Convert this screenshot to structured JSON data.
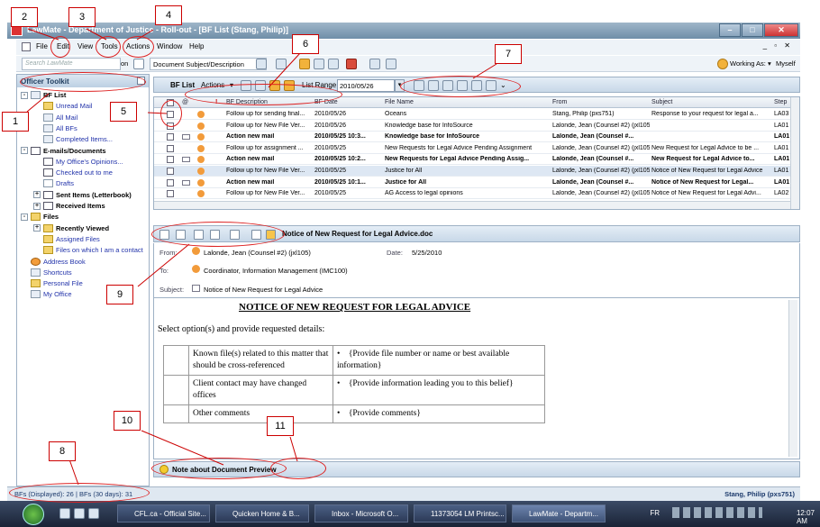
{
  "window": {
    "title": "LawMate - Department of Justice - Roll-out - [BF List (Stang, Philip)]"
  },
  "menu": [
    "File",
    "Edit",
    "View",
    "Tools",
    "Actions",
    "Window",
    "Help"
  ],
  "toolbar": {
    "search_placeholder": "Search LawMate",
    "on_label": "on",
    "search_scope": "Document Subject/Description",
    "working_as_label": "Working As:",
    "working_as_value": "Myself"
  },
  "sidebar": {
    "title": "Officer Toolkit",
    "items": [
      {
        "label": "BF List",
        "level": 0,
        "bold": true,
        "link": false,
        "icon": "list-icon",
        "toggle": "-"
      },
      {
        "label": "Unread Mail",
        "level": 1,
        "bold": false,
        "link": true,
        "icon": "folder-icon"
      },
      {
        "label": "All Mail",
        "level": 1,
        "bold": false,
        "link": true,
        "icon": "mail-icon"
      },
      {
        "label": "All BFs",
        "level": 1,
        "bold": false,
        "link": true,
        "icon": "list-icon"
      },
      {
        "label": "Completed Items...",
        "level": 1,
        "bold": false,
        "link": true,
        "icon": "check-icon"
      },
      {
        "label": "E-mails/Documents",
        "level": 0,
        "bold": true,
        "link": false,
        "icon": "document-icon",
        "toggle": "-"
      },
      {
        "label": "My Office's Opinions...",
        "level": 1,
        "bold": false,
        "link": true,
        "icon": "document-icon"
      },
      {
        "label": "Checked out to me",
        "level": 1,
        "bold": false,
        "link": true,
        "icon": "document-icon"
      },
      {
        "label": "Drafts",
        "level": 1,
        "bold": false,
        "link": true,
        "icon": "pencil-icon"
      },
      {
        "label": "Sent Items (Letterbook)",
        "level": 1,
        "bold": true,
        "link": false,
        "icon": "document-icon",
        "toggle": "+"
      },
      {
        "label": "Received Items",
        "level": 1,
        "bold": true,
        "link": false,
        "icon": "document-icon",
        "toggle": "+"
      },
      {
        "label": "Files",
        "level": 0,
        "bold": true,
        "link": false,
        "icon": "folder-icon",
        "toggle": "-"
      },
      {
        "label": "Recently Viewed",
        "level": 1,
        "bold": true,
        "link": false,
        "icon": "folder-icon",
        "toggle": "+"
      },
      {
        "label": "Assigned Files",
        "level": 1,
        "bold": false,
        "link": true,
        "icon": "folder-icon"
      },
      {
        "label": "Files on which I am a contact",
        "level": 1,
        "bold": false,
        "link": true,
        "icon": "folder-icon"
      },
      {
        "label": "Address Book",
        "level": 0,
        "bold": false,
        "link": true,
        "icon": "contacts-icon"
      },
      {
        "label": "Shortcuts",
        "level": 0,
        "bold": false,
        "link": true,
        "icon": "shortcut-icon"
      },
      {
        "label": "Personal File",
        "level": 0,
        "bold": false,
        "link": true,
        "icon": "folder-icon"
      },
      {
        "label": "My Office",
        "level": 0,
        "bold": false,
        "link": true,
        "icon": "office-icon"
      }
    ]
  },
  "bflist": {
    "title": "BF List",
    "actions_label": "Actions",
    "list_range_label": "List Range:",
    "list_range_value": "2010/05/26",
    "columns": [
      "BF Description",
      "BF Date",
      "File Name",
      "From",
      "Subject",
      "Step"
    ],
    "rows": [
      {
        "bold": false,
        "selected": false,
        "desc": "Follow up for sending final...",
        "date": "2010/05/26",
        "file": "Oceans",
        "from": "Stang, Philip (pxs751)",
        "subject": "Response to your request for legal a...",
        "step": "LA03"
      },
      {
        "bold": false,
        "selected": false,
        "desc": "Follow up for New File Ver...",
        "date": "2010/05/26",
        "file": "Knowledge base for InfoSource",
        "from": "Lalonde, Jean (Counsel #2) (jxl105)",
        "subject": "",
        "step": "LA01"
      },
      {
        "bold": true,
        "selected": false,
        "desc": "Action new mail",
        "date": "2010/05/25 10:3...",
        "file": "Knowledge base for InfoSource",
        "from": "Lalonde, Jean (Counsel #...",
        "subject": "",
        "step": "LA01"
      },
      {
        "bold": false,
        "selected": false,
        "desc": "Follow up for assignment ...",
        "date": "2010/05/25",
        "file": "New Requests for Legal Advice Pending Assignment",
        "from": "Lalonde, Jean (Counsel #2) (jxl105)",
        "subject": "New Request for Legal Advice to be ...",
        "step": "LA01"
      },
      {
        "bold": true,
        "selected": false,
        "desc": "Action new mail",
        "date": "2010/05/25 10:2...",
        "file": "New Requests for Legal Advice Pending Assig...",
        "from": "Lalonde, Jean (Counsel #...",
        "subject": "New Request for Legal Advice to...",
        "step": "LA01"
      },
      {
        "bold": false,
        "selected": true,
        "desc": "Follow up for New File Ver...",
        "date": "2010/05/25",
        "file": "Justice for All",
        "from": "Lalonde, Jean (Counsel #2) (jxl105)",
        "subject": "Notice of New Request for Legal Advice",
        "step": "LA01"
      },
      {
        "bold": true,
        "selected": false,
        "desc": "Action new mail",
        "date": "2010/05/25 10:1...",
        "file": "Justice for All",
        "from": "Lalonde, Jean (Counsel #...",
        "subject": "Notice of New Request for Legal...",
        "step": "LA01"
      },
      {
        "bold": false,
        "selected": false,
        "desc": "Follow up for New File Ver...",
        "date": "2010/05/25",
        "file": "AG Access to legal opinions",
        "from": "Lalonde, Jean (Counsel #2) (jxl105)",
        "subject": "Notice of New Request for Legal Advi...",
        "step": "LA02"
      },
      {
        "bold": true,
        "selected": false,
        "desc": "Action new mail",
        "date": "2010/05/25 9:11...",
        "file": "AG Access to legal opinions",
        "from": "Lalonde, Jean (Counsel #...",
        "subject": "",
        "step": "LA01"
      }
    ]
  },
  "preview": {
    "doc_name": "Notice of New Request for Legal Advice.doc",
    "from_label": "From:",
    "from_value": "Lalonde, Jean (Counsel #2) (jxl105)",
    "date_label": "Date:",
    "date_value": "5/25/2010",
    "to_label": "To:",
    "to_value": "Coordinator, Information Management (IMC100)",
    "subject_label": "Subject:",
    "subject_value": "Notice of New Request for Legal Advice"
  },
  "document": {
    "title": "NOTICE OF NEW REQUEST FOR LEGAL ADVICE",
    "intro": "Select option(s) and provide requested details:",
    "rows": [
      {
        "label": "Known file(s) related to this matter that should be cross-referenced",
        "value": "{Provide file number or name or best available information}"
      },
      {
        "label": "Client contact may have changed offices",
        "value": "{Provide information leading you to this belief}"
      },
      {
        "label": "Other comments",
        "value": "{Provide comments}"
      }
    ]
  },
  "note": {
    "label": "Note about Document Preview"
  },
  "status": {
    "left": "BFs (Displayed): 26 | BFs (30 days): 31",
    "right": "Stang, Philip (pxs751)"
  },
  "taskbar": {
    "tasks": [
      "CFL.ca - Official Site...",
      "Quicken Home & B...",
      "Inbox - Microsoft O...",
      "11373054 LM Printsc...",
      "LawMate - Departm..."
    ],
    "lang": "FR",
    "clock": "12:07 AM"
  },
  "callouts": [
    "1",
    "2",
    "3",
    "4",
    "5",
    "6",
    "7",
    "8",
    "9",
    "10",
    "11"
  ]
}
